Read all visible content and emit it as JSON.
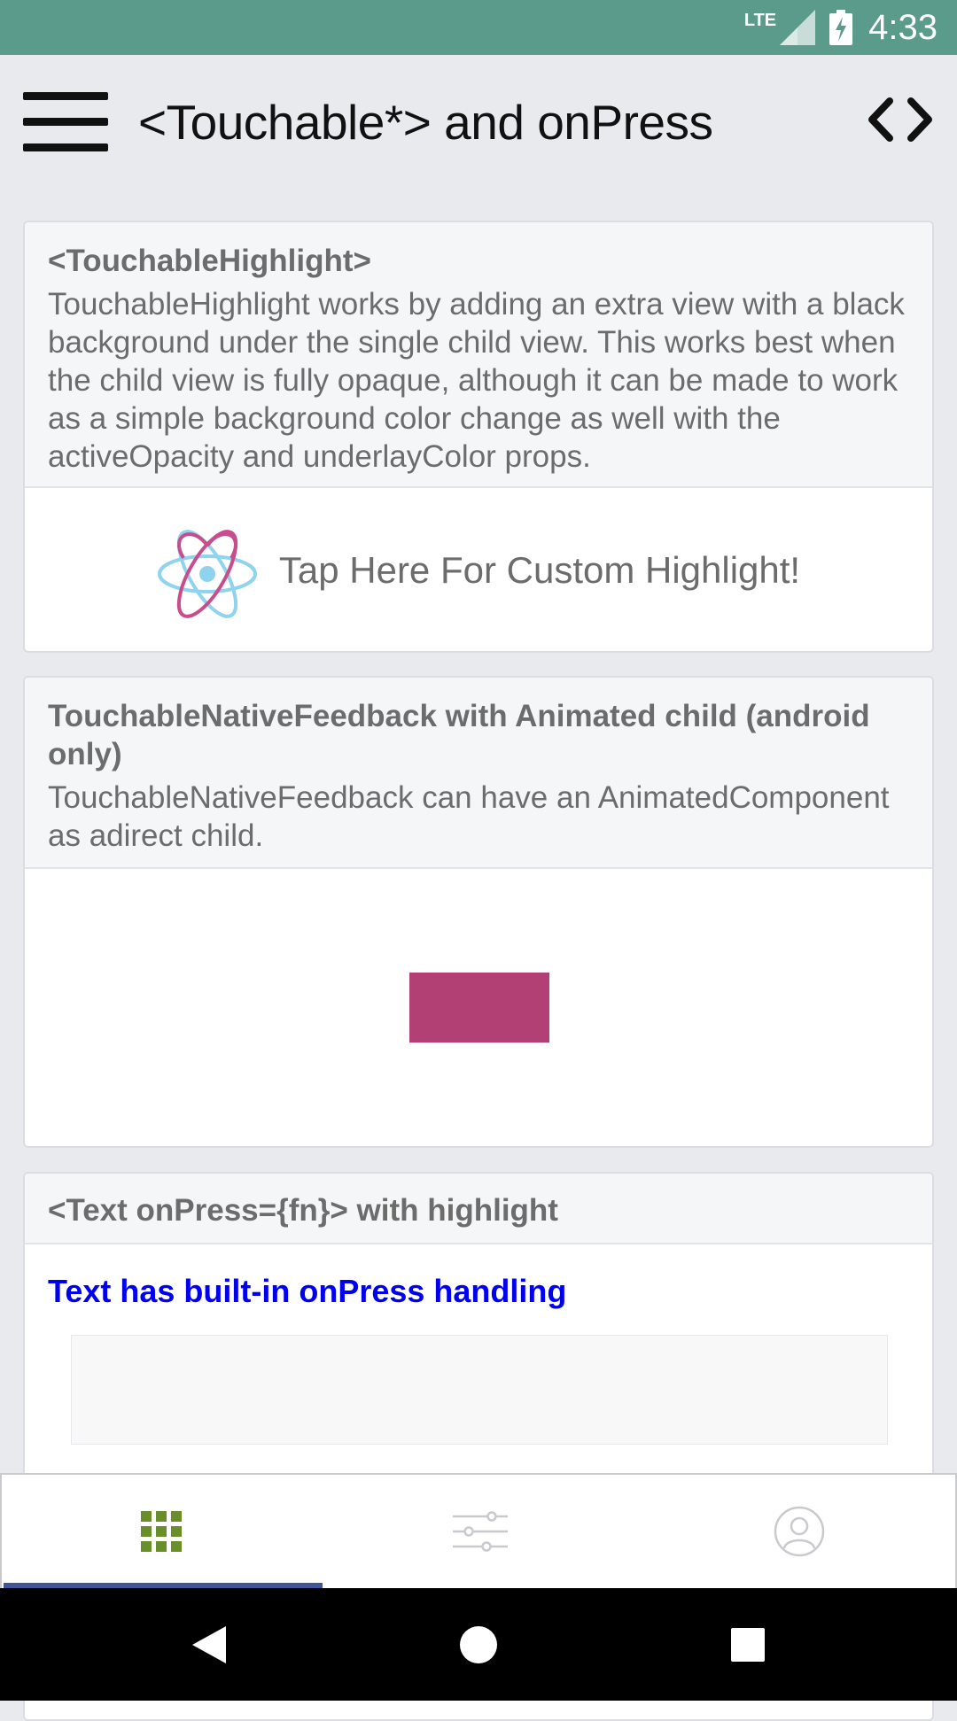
{
  "status_bar": {
    "network": "LTE",
    "time": "4:33",
    "background": "#5a9b8c"
  },
  "header": {
    "title": "<Touchable*> and onPress",
    "menu_icon": "menu-icon",
    "code_icon": "code-icon"
  },
  "cards": [
    {
      "title": "<TouchableHighlight>",
      "description": "TouchableHighlight works by adding an extra view with a black background under the single child view.  This works best when the child view is fully opaque, although it can be made to work as a simple background color change as well with the activeOpacity and underlayColor props.",
      "button_label": "Tap Here For Custom Highlight!",
      "button_icon": "react-logo-icon"
    },
    {
      "title": "TouchableNativeFeedback with Animated child (android only)",
      "description": "TouchableNativeFeedback can have an AnimatedComponent as adirect child.",
      "animated_color": "#b34075"
    },
    {
      "title": "<Text onPress={fn}> with highlight",
      "press_text": "Text has built-in onPress handling",
      "press_color": "#0000f0"
    }
  ],
  "tabs": [
    {
      "icon": "grid-icon",
      "active": true,
      "color": "#6a8f2a"
    },
    {
      "icon": "sliders-icon",
      "active": false
    },
    {
      "icon": "user-icon",
      "active": false
    }
  ],
  "nav_bar": {
    "back": "back-icon",
    "home": "home-icon",
    "recents": "recents-icon"
  }
}
